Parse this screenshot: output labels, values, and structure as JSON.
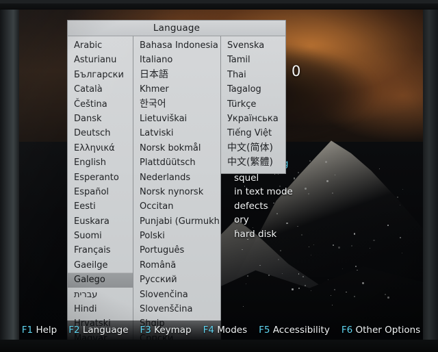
{
  "dialog": {
    "title": "Language",
    "columns": [
      {
        "id": "column-1",
        "items": [
          "Arabic",
          "Asturianu",
          "Български",
          "Català",
          "Čeština",
          "Dansk",
          "Deutsch",
          "Ελληνικά",
          "English",
          "Esperanto",
          "Español",
          "Eesti",
          "Euskara",
          "Suomi",
          "Français",
          "Gaeilge",
          "Galego",
          "עברית",
          "Hindi",
          "Hrvatski",
          "Magyar"
        ],
        "selected": "Galego"
      },
      {
        "id": "column-2",
        "items": [
          "Bahasa Indonesia",
          "Italiano",
          "日本語",
          "Khmer",
          "한국어",
          "Lietuviškai",
          "Latviski",
          "Norsk bokmål",
          "Plattdüütsch",
          "Nederlands",
          "Norsk nynorsk",
          "Occitan",
          "Punjabi (Gurmukhi)",
          "Polski",
          "Português",
          "Română",
          "Русский",
          "Slovenčina",
          "Slovenščina",
          "Shqip",
          "Српски"
        ],
        "selected": null
      },
      {
        "id": "column-3",
        "items": [
          "Svenska",
          "Tamil",
          "Thai",
          "Tagalog",
          "Türkçe",
          "Українська",
          "Tiếng Việt",
          "中文(简体)",
          "中文(繁體)"
        ],
        "selected": null
      }
    ]
  },
  "background_menu": {
    "lines": [
      {
        "text": "ut installing",
        "highlighted": true
      },
      {
        "text": "squel",
        "highlighted": false
      },
      {
        "text": "in text mode",
        "highlighted": false
      },
      {
        "text": " defects",
        "highlighted": false
      },
      {
        "text": "ory",
        "highlighted": false
      },
      {
        "text": "hard disk",
        "highlighted": false
      }
    ],
    "stray_glyph": "0"
  },
  "function_bar": {
    "keys": [
      {
        "key": "F1",
        "label": "Help"
      },
      {
        "key": "F2",
        "label": "Language"
      },
      {
        "key": "F3",
        "label": "Keymap"
      },
      {
        "key": "F4",
        "label": "Modes"
      },
      {
        "key": "F5",
        "label": "Accessibility"
      },
      {
        "key": "F6",
        "label": "Other Options"
      }
    ]
  },
  "colors": {
    "dialog_face": "#cdd0d2",
    "dialog_border": "#8e9194",
    "selection": "#94979a",
    "fkey_accent": "#5fd4f0",
    "fkey_label": "#eef1f2",
    "menu_highlight": "#5ad2ee"
  }
}
